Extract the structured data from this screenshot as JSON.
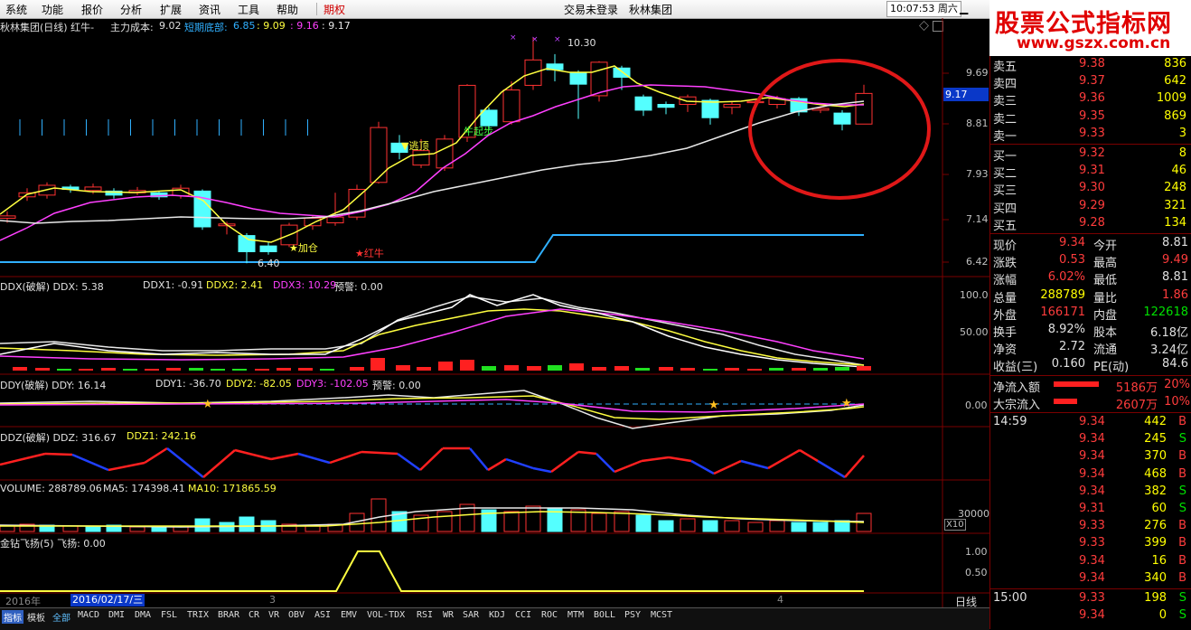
{
  "menu": {
    "items": [
      "系统",
      "功能",
      "报价",
      "分析",
      "扩展",
      "资讯",
      "工具",
      "帮助"
    ],
    "active": "期权",
    "login_status": "交易未登录",
    "stock_title": "秋林集团",
    "clock": "10:07:53",
    "weekday": "周六"
  },
  "banner": {
    "title": "股票公式指标网",
    "url": "www.gszx.com.cn"
  },
  "chart_header": {
    "name": "秋林集团(日线) 红牛-",
    "cost_label": "主力成本:",
    "cost_value": "9.02",
    "short_label": "短期底部:",
    "short_value": "6.85",
    "v2": ": 9.09",
    "v3": ": 9.16",
    "v4": ": 9.17"
  },
  "price_axis": [
    "9.69",
    "8.81",
    "7.93",
    "7.14",
    "6.42"
  ],
  "price_current": "9.17",
  "annotations": {
    "high": "10.30",
    "low": "6.40",
    "escape": "逃顶",
    "bull_start": "牛起步",
    "add": "加仓",
    "red_bull": "红牛"
  },
  "ddx": {
    "header": "DDX(破解) DDX: 5.38",
    "ddx1": "DDX1: -0.91",
    "ddx2": "DDX2: 2.41",
    "ddx3": "DDX3: 10.29",
    "warn": "预警: 0.00",
    "axis": [
      "100.0",
      "50.00"
    ]
  },
  "ddy": {
    "header": "DDY(破解) DDY: 16.14",
    "ddy1": "DDY1: -36.70",
    "ddy2": "DDY2: -82.05",
    "ddy3": "DDY3: -102.05",
    "warn": "预警: 0.00",
    "axis": [
      "0.00"
    ]
  },
  "ddz": {
    "header": "DDZ(破解) DDZ: 316.67",
    "ddz1": "DDZ1: 242.16"
  },
  "volume": {
    "header": "VOLUME: 288789.06",
    "ma5": "MA5: 174398.41",
    "ma10": "MA10: 171865.59",
    "axis": "30000",
    "unit": "X10"
  },
  "jinzuan": {
    "header": "金钻飞扬(5) 飞扬: 0.00",
    "axis": [
      "1.00",
      "0.50"
    ]
  },
  "date_axis": {
    "year": "2016年",
    "cursor": "2016/02/17/三",
    "m3": "3",
    "m4": "4",
    "period": "日线"
  },
  "order_book": {
    "sell": [
      {
        "label": "卖五",
        "price": "9.38",
        "vol": "836"
      },
      {
        "label": "卖四",
        "price": "9.37",
        "vol": "642"
      },
      {
        "label": "卖三",
        "price": "9.36",
        "vol": "1009"
      },
      {
        "label": "卖二",
        "price": "9.35",
        "vol": "869"
      },
      {
        "label": "卖一",
        "price": "9.33",
        "vol": "3"
      }
    ],
    "buy": [
      {
        "label": "买一",
        "price": "9.32",
        "vol": "8"
      },
      {
        "label": "买二",
        "price": "9.31",
        "vol": "46"
      },
      {
        "label": "买三",
        "price": "9.30",
        "vol": "248"
      },
      {
        "label": "买四",
        "price": "9.29",
        "vol": "321"
      },
      {
        "label": "买五",
        "price": "9.28",
        "vol": "134"
      }
    ]
  },
  "stats": [
    {
      "l1": "现价",
      "v1": "9.34",
      "c1": "red",
      "l2": "今开",
      "v2": "8.81",
      "c2": "wht"
    },
    {
      "l1": "涨跌",
      "v1": "0.53",
      "c1": "red",
      "l2": "最高",
      "v2": "9.49",
      "c2": "red"
    },
    {
      "l1": "涨幅",
      "v1": "6.02%",
      "c1": "red",
      "l2": "最低",
      "v2": "8.81",
      "c2": "wht"
    },
    {
      "l1": "总量",
      "v1": "288789",
      "c1": "yel",
      "l2": "量比",
      "v2": "1.86",
      "c2": "red"
    },
    {
      "l1": "外盘",
      "v1": "166171",
      "c1": "red",
      "l2": "内盘",
      "v2": "122618",
      "c2": "grn"
    },
    {
      "l1": "换手",
      "v1": "8.92%",
      "c1": "wht",
      "l2": "股本",
      "v2": "6.18亿",
      "c2": "wht"
    },
    {
      "l1": "净资",
      "v1": "2.72",
      "c1": "wht",
      "l2": "流通",
      "v2": "3.24亿",
      "c2": "wht"
    },
    {
      "l1": "收益(三)",
      "v1": "0.160",
      "c1": "wht",
      "l2": "PE(动)",
      "v2": "84.6",
      "c2": "wht"
    }
  ],
  "flows": [
    {
      "label": "净流入额",
      "value": "5186万",
      "pct": "20%"
    },
    {
      "label": "大宗流入",
      "value": "2607万",
      "pct": "10%"
    }
  ],
  "ticks": [
    {
      "time": "14:59",
      "price": "9.34",
      "vol": "442",
      "side": "B"
    },
    {
      "time": "",
      "price": "9.34",
      "vol": "245",
      "side": "S"
    },
    {
      "time": "",
      "price": "9.34",
      "vol": "370",
      "side": "B"
    },
    {
      "time": "",
      "price": "9.34",
      "vol": "468",
      "side": "B"
    },
    {
      "time": "",
      "price": "9.34",
      "vol": "382",
      "side": "S"
    },
    {
      "time": "",
      "price": "9.31",
      "vol": "60",
      "side": "S"
    },
    {
      "time": "",
      "price": "9.33",
      "vol": "276",
      "side": "B"
    },
    {
      "time": "",
      "price": "9.33",
      "vol": "399",
      "side": "B"
    },
    {
      "time": "",
      "price": "9.34",
      "vol": "16",
      "side": "B"
    },
    {
      "time": "",
      "price": "9.34",
      "vol": "340",
      "side": "B"
    },
    {
      "time": "15:00",
      "price": "9.33",
      "vol": "198",
      "side": "S"
    },
    {
      "time": "",
      "price": "9.34",
      "vol": "0",
      "side": "S"
    }
  ],
  "bottom_tabs": [
    "指标",
    "模板",
    "全部",
    "MACD",
    "DMI",
    "DMA",
    "FSL",
    "TRIX",
    "BRAR",
    "CR",
    "VR",
    "OBV",
    "ASI",
    "EMV",
    "VOL-TDX",
    "RSI",
    "WR",
    "SAR",
    "KDJ",
    "CCI",
    "ROC",
    "MTM",
    "BOLL",
    "PSY",
    "MCST"
  ],
  "colors": {
    "up": "#ff3232",
    "down": "#54ffff",
    "ma_yellow": "#ffff40",
    "ma_magenta": "#ff40ff",
    "ma_white": "#e8e8e8",
    "support": "#30b0ff",
    "grid": "#7a0000"
  }
}
